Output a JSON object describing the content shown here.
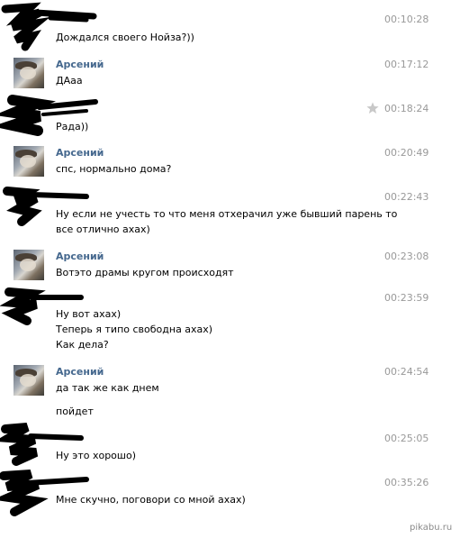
{
  "messages": [
    {
      "author": "",
      "time": "00:10:28",
      "lines": [
        "Дождался своего Нойза?))"
      ]
    },
    {
      "author": "Арсений",
      "time": "00:17:12",
      "lines": [
        "ДАаа"
      ]
    },
    {
      "author": "",
      "time": "00:18:24",
      "lines": [
        "Рада))"
      ]
    },
    {
      "author": "Арсений",
      "time": "00:20:49",
      "lines": [
        "спс, нормально дома?"
      ]
    },
    {
      "author": "",
      "time": "00:22:43",
      "lines": [
        "Ну если не учесть то что меня отхерачил уже бывший парень то",
        "все отлично ахах)"
      ]
    },
    {
      "author": "Арсений",
      "time": "00:23:08",
      "lines": [
        "Вотэто драмы кругом происходят"
      ]
    },
    {
      "author": "",
      "time": "00:23:59",
      "lines": [
        "Ну вот ахах)",
        "Теперь я типо свободна ахах)",
        "Как дела?"
      ]
    },
    {
      "author": "Арсений",
      "time": "00:24:54",
      "lines": [
        "да так же как днем"
      ]
    },
    {
      "author": "",
      "time": "",
      "lines": [
        "пойдет"
      ]
    },
    {
      "author": "",
      "time": "00:25:05",
      "lines": [
        "Ну это хорошо)"
      ]
    },
    {
      "author": "",
      "time": "00:35:26",
      "lines": [
        "Мне скучно, поговори со мной ахах)"
      ]
    }
  ],
  "icons": {
    "favorite": "star-icon"
  },
  "colors": {
    "author": "#45688e",
    "time": "#999999",
    "redaction": "#000000"
  },
  "watermark": "pikabu.ru"
}
